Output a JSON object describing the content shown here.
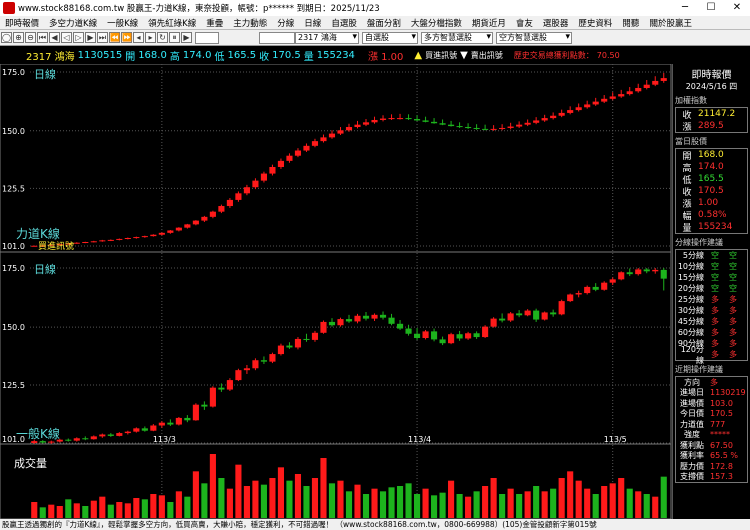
{
  "window": {
    "title": "www.stock88168.com.tw 股贏王-力道K線，東奈投顧，帳號：p****** 到期日：2025/11/23"
  },
  "menu": [
    "即時報價",
    "多空力道K線",
    "一般K線",
    "領先紅綠K線",
    "重疊",
    "主力動態",
    "分線",
    "日線",
    "自選股",
    "盤面分割",
    "大盤分檔指數",
    "期貨近月",
    "會友",
    "選股器",
    "歷史資料",
    "閱聽",
    "關於股贏王"
  ],
  "toolbar": {
    "symbol": "2317 鴻海",
    "select1": "自選股",
    "select2": "多方智慧選股",
    "select3": "空方智慧選股"
  },
  "quote": {
    "code_name": "2317 鴻海",
    "date": "1130515",
    "open_label": "開",
    "open": "168.0",
    "high_label": "高",
    "high": "174.0",
    "low_label": "低",
    "low": "165.5",
    "close_label": "收",
    "close": "170.5",
    "vol_label": "量",
    "vol": "155234",
    "change_label": "漲 1.00",
    "buy_signal": "買進訊號",
    "sell_signal": "賣出訊號",
    "history_label": "歷史交易總獲利點數：",
    "history_value": "70.50",
    "cum_label": "本頁累計獲利點數：",
    "cum_value": "67.50"
  },
  "chart_labels": {
    "upper_title": "日線",
    "upper_name": "力道K線",
    "upper_signal": "買進訊號",
    "middle_title": "日線",
    "middle_name": "一般K線",
    "lower_title": "成交量"
  },
  "chart_data": {
    "type": "candlestick",
    "y_ticks": [
      "175.0",
      "150.0",
      "125.5",
      "101.0"
    ],
    "ylim": [
      101,
      175
    ],
    "x_ticks": [
      "113/3",
      "113/4",
      "113/5"
    ],
    "candles": [
      [
        101.0,
        101.2,
        100.8,
        101.1
      ],
      [
        101.1,
        101.5,
        100.9,
        101.3
      ],
      [
        101.3,
        101.8,
        101.0,
        101.6
      ],
      [
        101.6,
        102.0,
        101.3,
        101.8
      ],
      [
        101.8,
        102.3,
        101.5,
        102.1
      ],
      [
        102.1,
        102.6,
        101.9,
        102.4
      ],
      [
        102.4,
        102.8,
        102.2,
        102.7
      ],
      [
        102.7,
        103.2,
        102.5,
        103.0
      ],
      [
        103.0,
        103.6,
        102.8,
        103.4
      ],
      [
        103.4,
        103.8,
        103.1,
        103.6
      ],
      [
        103.6,
        104.2,
        103.4,
        104.0
      ],
      [
        104.0,
        104.6,
        103.8,
        104.4
      ],
      [
        104.4,
        105.0,
        104.1,
        104.8
      ],
      [
        104.8,
        105.4,
        104.5,
        105.2
      ],
      [
        105.2,
        106.0,
        105.0,
        105.8
      ],
      [
        105.8,
        106.8,
        105.5,
        106.6
      ],
      [
        106.6,
        107.8,
        106.2,
        107.6
      ],
      [
        107.6,
        109.0,
        107.2,
        108.8
      ],
      [
        108.8,
        110.4,
        108.4,
        110.2
      ],
      [
        110.2,
        112.0,
        109.8,
        111.8
      ],
      [
        111.8,
        113.8,
        111.2,
        113.4
      ],
      [
        113.4,
        116.0,
        112.8,
        115.6
      ],
      [
        115.6,
        118.6,
        115.0,
        118.0
      ],
      [
        118.0,
        121.4,
        117.2,
        120.6
      ],
      [
        120.6,
        124.2,
        119.8,
        123.4
      ],
      [
        123.4,
        127.0,
        122.6,
        126.0
      ],
      [
        126.0,
        129.8,
        125.2,
        128.8
      ],
      [
        128.8,
        132.6,
        128.0,
        131.8
      ],
      [
        131.8,
        135.6,
        131.0,
        134.6
      ],
      [
        134.6,
        138.2,
        133.8,
        137.2
      ],
      [
        137.2,
        140.4,
        136.4,
        139.4
      ],
      [
        139.4,
        142.6,
        138.8,
        141.6
      ],
      [
        141.6,
        144.6,
        141.0,
        143.6
      ],
      [
        143.6,
        146.6,
        143.0,
        145.6
      ],
      [
        145.6,
        148.4,
        145.0,
        147.2
      ],
      [
        147.2,
        150.2,
        146.6,
        148.8
      ],
      [
        148.8,
        151.6,
        148.2,
        150.2
      ],
      [
        150.2,
        153.0,
        149.6,
        151.6
      ],
      [
        151.6,
        154.2,
        151.0,
        152.6
      ],
      [
        152.6,
        155.0,
        152.0,
        153.6
      ],
      [
        153.6,
        156.0,
        153.0,
        154.6
      ],
      [
        154.6,
        156.6,
        154.0,
        155.2
      ],
      [
        155.2,
        157.0,
        154.6,
        155.4
      ],
      [
        155.4,
        157.2,
        154.8,
        155.4
      ],
      [
        155.4,
        157.0,
        154.6,
        155.0
      ],
      [
        155.0,
        156.6,
        154.2,
        154.4
      ],
      [
        154.4,
        156.0,
        153.6,
        153.8
      ],
      [
        153.8,
        155.4,
        153.0,
        153.2
      ],
      [
        153.2,
        154.8,
        152.4,
        152.6
      ],
      [
        152.6,
        154.2,
        151.8,
        152.0
      ],
      [
        152.0,
        153.6,
        151.2,
        151.6
      ],
      [
        151.6,
        153.2,
        150.8,
        151.2
      ],
      [
        151.2,
        152.8,
        150.4,
        150.8
      ],
      [
        150.8,
        152.6,
        150.2,
        150.6
      ],
      [
        150.6,
        152.4,
        150.0,
        150.8
      ],
      [
        150.8,
        152.8,
        150.2,
        151.2
      ],
      [
        151.2,
        153.4,
        150.6,
        151.8
      ],
      [
        151.8,
        154.0,
        151.2,
        152.6
      ],
      [
        152.6,
        154.8,
        152.0,
        153.4
      ],
      [
        153.4,
        155.8,
        152.8,
        154.4
      ],
      [
        154.4,
        156.8,
        153.8,
        155.4
      ],
      [
        155.4,
        157.8,
        154.8,
        156.4
      ],
      [
        156.4,
        159.0,
        155.8,
        157.6
      ],
      [
        157.6,
        160.4,
        157.0,
        158.8
      ],
      [
        158.8,
        161.6,
        158.2,
        160.0
      ],
      [
        160.0,
        162.8,
        159.4,
        161.2
      ],
      [
        161.2,
        164.0,
        160.6,
        162.4
      ],
      [
        162.4,
        165.2,
        161.8,
        163.6
      ],
      [
        163.6,
        166.4,
        163.0,
        164.6
      ],
      [
        164.6,
        167.4,
        164.0,
        165.6
      ],
      [
        165.6,
        168.6,
        165.0,
        166.8
      ],
      [
        166.8,
        170.0,
        166.2,
        168.2
      ],
      [
        168.2,
        171.6,
        167.6,
        169.6
      ],
      [
        169.6,
        173.2,
        169.0,
        171.2
      ],
      [
        171.2,
        174.6,
        170.4,
        172.4
      ]
    ],
    "ohlc": [
      [
        101.0,
        102.4,
        100.6,
        101.8
      ],
      [
        101.8,
        102.2,
        100.8,
        101.2
      ],
      [
        101.2,
        102.0,
        100.6,
        101.6
      ],
      [
        101.6,
        102.8,
        101.2,
        102.4
      ],
      [
        102.4,
        102.9,
        101.6,
        102.0
      ],
      [
        102.0,
        103.4,
        101.6,
        103.0
      ],
      [
        103.0,
        103.8,
        102.2,
        102.6
      ],
      [
        102.6,
        104.2,
        102.4,
        103.8
      ],
      [
        103.8,
        105.0,
        103.2,
        104.6
      ],
      [
        104.6,
        105.2,
        103.6,
        104.0
      ],
      [
        104.0,
        105.6,
        103.8,
        105.2
      ],
      [
        105.2,
        106.2,
        104.6,
        105.8
      ],
      [
        105.8,
        107.6,
        105.4,
        107.2
      ],
      [
        107.2,
        108.0,
        105.8,
        106.2
      ],
      [
        106.2,
        109.0,
        106.0,
        108.4
      ],
      [
        108.4,
        110.2,
        107.4,
        109.6
      ],
      [
        109.6,
        111.0,
        108.2,
        108.8
      ],
      [
        108.8,
        112.0,
        108.4,
        111.6
      ],
      [
        111.6,
        112.8,
        109.8,
        110.6
      ],
      [
        110.6,
        117.8,
        110.4,
        117.2
      ],
      [
        117.2,
        118.6,
        115.0,
        116.4
      ],
      [
        116.4,
        125.0,
        116.0,
        124.4
      ],
      [
        124.4,
        126.2,
        122.6,
        123.6
      ],
      [
        123.6,
        128.4,
        123.0,
        127.6
      ],
      [
        127.6,
        132.4,
        127.2,
        131.8
      ],
      [
        131.8,
        134.0,
        130.2,
        132.6
      ],
      [
        132.6,
        136.8,
        131.8,
        136.0
      ],
      [
        136.0,
        137.6,
        134.4,
        135.4
      ],
      [
        135.4,
        139.2,
        134.8,
        138.6
      ],
      [
        138.6,
        143.0,
        138.0,
        142.2
      ],
      [
        142.2,
        143.6,
        140.8,
        141.4
      ],
      [
        141.4,
        145.8,
        140.6,
        145.0
      ],
      [
        145.0,
        147.2,
        143.8,
        144.6
      ],
      [
        144.6,
        148.4,
        143.8,
        147.6
      ],
      [
        147.6,
        152.8,
        147.2,
        152.2
      ],
      [
        152.2,
        153.8,
        150.2,
        150.8
      ],
      [
        150.8,
        154.0,
        150.2,
        153.4
      ],
      [
        153.4,
        155.2,
        151.8,
        152.4
      ],
      [
        152.4,
        155.6,
        151.6,
        154.8
      ],
      [
        154.8,
        156.4,
        152.8,
        153.6
      ],
      [
        153.6,
        155.8,
        152.6,
        155.2
      ],
      [
        155.2,
        156.6,
        153.2,
        154.0
      ],
      [
        154.0,
        155.6,
        150.8,
        151.4
      ],
      [
        151.4,
        153.0,
        148.8,
        149.4
      ],
      [
        149.4,
        151.0,
        146.4,
        147.2
      ],
      [
        147.2,
        149.6,
        144.6,
        145.4
      ],
      [
        145.4,
        148.8,
        144.8,
        148.2
      ],
      [
        148.2,
        149.4,
        144.0,
        144.8
      ],
      [
        144.8,
        146.0,
        142.4,
        143.2
      ],
      [
        143.2,
        147.6,
        142.8,
        147.0
      ],
      [
        147.0,
        148.4,
        144.2,
        145.2
      ],
      [
        145.2,
        148.0,
        144.6,
        147.4
      ],
      [
        147.4,
        148.2,
        145.0,
        145.8
      ],
      [
        145.8,
        150.8,
        145.4,
        150.2
      ],
      [
        150.2,
        154.2,
        149.8,
        153.6
      ],
      [
        153.6,
        155.8,
        152.0,
        152.8
      ],
      [
        152.8,
        156.4,
        152.2,
        155.8
      ],
      [
        155.8,
        157.2,
        154.2,
        155.0
      ],
      [
        155.0,
        157.6,
        154.6,
        157.0
      ],
      [
        157.0,
        157.8,
        152.2,
        153.2
      ],
      [
        153.2,
        156.6,
        152.8,
        156.2
      ],
      [
        156.2,
        157.4,
        154.4,
        155.4
      ],
      [
        155.4,
        161.6,
        155.0,
        161.0
      ],
      [
        161.0,
        164.2,
        160.6,
        163.8
      ],
      [
        163.8,
        165.4,
        162.6,
        164.4
      ],
      [
        164.4,
        167.6,
        163.8,
        167.0
      ],
      [
        167.0,
        168.6,
        165.2,
        165.8
      ],
      [
        165.8,
        169.4,
        165.4,
        168.8
      ],
      [
        168.8,
        171.0,
        167.8,
        170.2
      ],
      [
        170.2,
        173.6,
        169.8,
        173.2
      ],
      [
        173.2,
        174.8,
        171.6,
        172.4
      ],
      [
        172.4,
        175.0,
        171.8,
        174.4
      ],
      [
        174.4,
        175.0,
        172.8,
        173.6
      ],
      [
        173.6,
        175.0,
        172.6,
        174.2
      ],
      [
        174.2,
        175.0,
        165.5,
        170.5
      ]
    ],
    "volumes": [
      12,
      8,
      10,
      9,
      14,
      11,
      9,
      13,
      16,
      10,
      12,
      11,
      15,
      14,
      18,
      17,
      12,
      20,
      16,
      35,
      26,
      48,
      30,
      22,
      40,
      24,
      28,
      25,
      30,
      38,
      28,
      33,
      24,
      30,
      45,
      26,
      28,
      20,
      25,
      18,
      22,
      20,
      23,
      24,
      26,
      18,
      22,
      17,
      19,
      28,
      18,
      16,
      20,
      24,
      30,
      18,
      22,
      18,
      20,
      24,
      20,
      22,
      30,
      35,
      28,
      22,
      18,
      24,
      26,
      30,
      22,
      20,
      18,
      16,
      31
    ],
    "volume_up": [
      1,
      0,
      1,
      1,
      0,
      1,
      0,
      1,
      1,
      0,
      1,
      1,
      1,
      0,
      1,
      1,
      0,
      1,
      0,
      1,
      0,
      1,
      0,
      1,
      1,
      1,
      1,
      0,
      1,
      1,
      0,
      1,
      0,
      1,
      1,
      0,
      1,
      0,
      1,
      0,
      1,
      0,
      0,
      0,
      0,
      0,
      1,
      0,
      0,
      1,
      0,
      1,
      0,
      1,
      1,
      0,
      1,
      0,
      1,
      0,
      1,
      0,
      1,
      1,
      1,
      1,
      0,
      1,
      1,
      1,
      0,
      1,
      0,
      1,
      0
    ]
  },
  "right_panel": {
    "head_title": "即時報價",
    "head_date": "2024/5/16 四",
    "index_title": "加權指數",
    "index_close_label": "收",
    "index_close": "21147.2",
    "index_change_label": "漲",
    "index_change": "289.5",
    "day_title": "當日股價",
    "day_rows": [
      {
        "k": "開",
        "v": "168.0",
        "c": "yel"
      },
      {
        "k": "高",
        "v": "174.0",
        "c": "red"
      },
      {
        "k": "低",
        "v": "165.5",
        "c": "grn"
      },
      {
        "k": "收",
        "v": "170.5",
        "c": "red"
      },
      {
        "k": "漲",
        "v": "1.00",
        "c": "red"
      },
      {
        "k": "幅",
        "v": "0.58%",
        "c": "red"
      },
      {
        "k": "量",
        "v": "155234",
        "c": "red"
      }
    ],
    "ops_title": "分線操作建議",
    "ops": [
      {
        "k": "5分線",
        "a": "空",
        "b": "空",
        "ac": "grn",
        "bc": "grn"
      },
      {
        "k": "10分線",
        "a": "空",
        "b": "空",
        "ac": "grn",
        "bc": "grn"
      },
      {
        "k": "15分線",
        "a": "空",
        "b": "空",
        "ac": "grn",
        "bc": "grn"
      },
      {
        "k": "20分線",
        "a": "空",
        "b": "空",
        "ac": "grn",
        "bc": "grn"
      },
      {
        "k": "25分線",
        "a": "多",
        "b": "多",
        "ac": "red",
        "bc": "red"
      },
      {
        "k": "30分線",
        "a": "多",
        "b": "多",
        "ac": "red",
        "bc": "red"
      },
      {
        "k": "45分線",
        "a": "多",
        "b": "多",
        "ac": "red",
        "bc": "red"
      },
      {
        "k": "60分線",
        "a": "多",
        "b": "多",
        "ac": "red",
        "bc": "red"
      },
      {
        "k": "90分線",
        "a": "多",
        "b": "多",
        "ac": "red",
        "bc": "red"
      },
      {
        "k": "120分線",
        "a": "多",
        "b": "多",
        "ac": "red",
        "bc": "red"
      }
    ],
    "recent_title": "近期操作建議",
    "recent": [
      {
        "k": "方向",
        "v": "多",
        "c": "red"
      },
      {
        "k": "進場日",
        "v": "1130219",
        "c": "red"
      },
      {
        "k": "進場價",
        "v": "103.0",
        "c": "red"
      },
      {
        "k": "今日價",
        "v": "170.5",
        "c": "red"
      },
      {
        "k": "力道值",
        "v": "777",
        "c": "red"
      },
      {
        "k": "強度",
        "v": "*****",
        "c": "red"
      },
      {
        "k": "獲利點",
        "v": "67.50",
        "c": "red"
      },
      {
        "k": "獲利率",
        "v": "65.5 %",
        "c": "red"
      },
      {
        "k": "壓力價",
        "v": "172.8",
        "c": "red"
      },
      {
        "k": "支撐價",
        "v": "157.3",
        "c": "red"
      }
    ]
  },
  "statusbar": "股贏王透過獨創的『力道K線』，輕鬆掌握多空方向，低買高賣，大賺小賠，穩定獲利，不可錯過喔！ （www.stock88168.com.tw，0800-669988）(105)金管投顧新字第015號"
}
